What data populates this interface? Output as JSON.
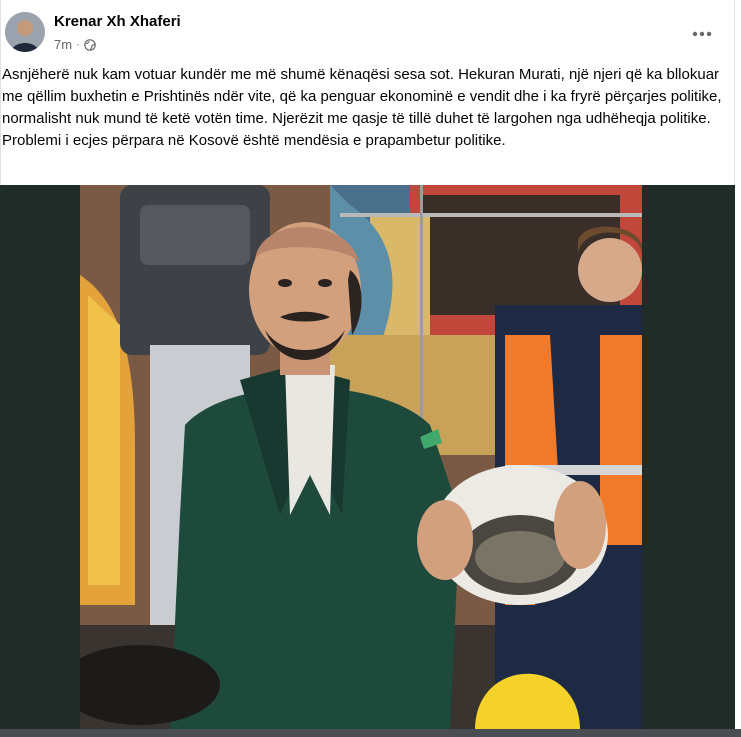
{
  "post": {
    "author": "Krenar Xh Xhaferi",
    "time": "7m",
    "privacy_icon": "globe-icon",
    "more_icon": "more-horizontal-icon",
    "text": "Asnjëherë nuk kam votuar kundër me më shumë kënaqësi sesa sot. Hekuran Murati, një njeri që ka bllokuar me qëllim buxhetin e Prishtinës ndër vite, që ka penguar ekonominë e vendit dhe i ka fryrë përçarjes politike, normalisht nuk mund të ketë votën time. Njerëzit me qasje të tillë duhet të largohen nga udhëheqja politike. Problemi i ecjes përpara në Kosovë është mendësia e prapambetur politike."
  },
  "colors": {
    "photo_band": "#1f2c28",
    "jacket": "#1e4a3c",
    "vest": "#f07a2a"
  }
}
